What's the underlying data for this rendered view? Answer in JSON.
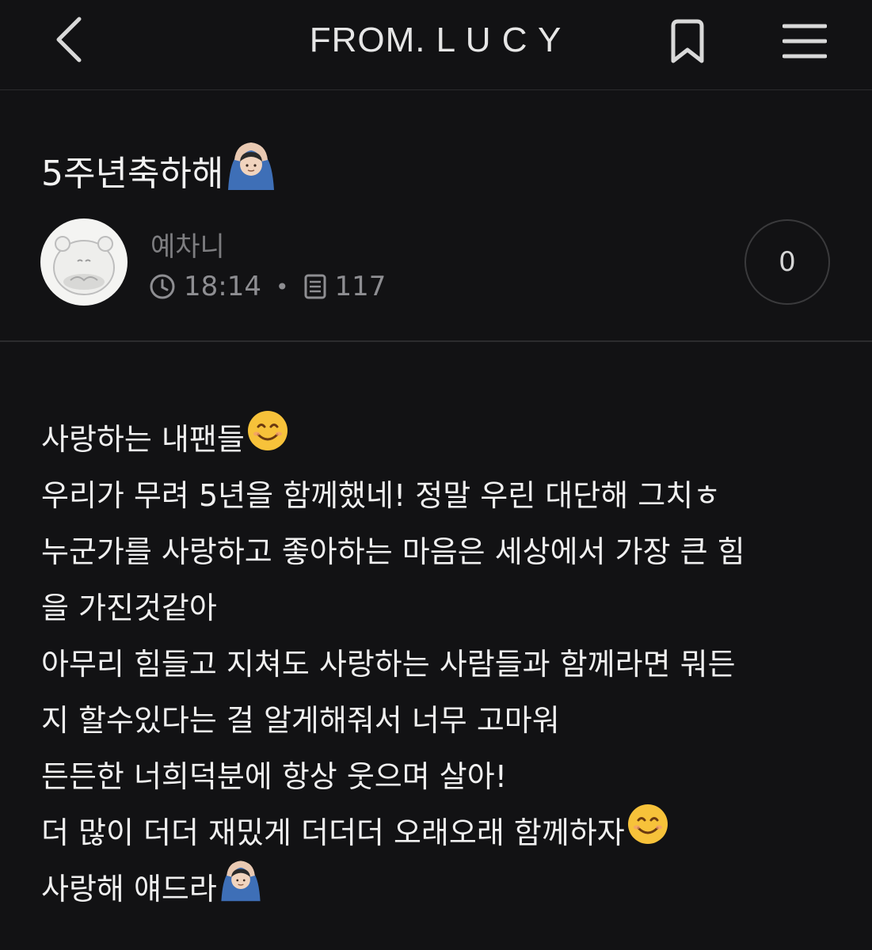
{
  "header": {
    "title": "FROM. L U C Y",
    "back_icon": "chevron-left-icon",
    "bookmark_icon": "bookmark-icon",
    "menu_icon": "hamburger-menu-icon"
  },
  "post": {
    "title": "5주년축하해",
    "title_emoji": "person-gesturing-ok-emoji",
    "author": "예차니",
    "time": "18:14",
    "time_icon": "clock-icon",
    "views": "117",
    "views_icon": "document-icon",
    "comment_count": "0",
    "body_lines": [
      {
        "text": "사랑하는 내팬들",
        "emoji": "smiling-face-emoji"
      },
      {
        "text": "우리가 무려 5년을 함께했네! 정말 우린 대단해 그치ㅎ"
      },
      {
        "text": "누군가를 사랑하고 좋아하는 마음은 세상에서 가장 큰 힘"
      },
      {
        "text": "을 가진것같아"
      },
      {
        "text": "아무리 힘들고 지쳐도 사랑하는 사람들과 함께라면 뭐든"
      },
      {
        "text": "지 할수있다는 걸 알게해줘서 너무 고마워"
      },
      {
        "text": "든든한 너희덕분에 항상 웃으며 살아!"
      },
      {
        "text": "더 많이 더더 재밌게 더더더 오래오래 함께하자",
        "emoji": "smiling-face-emoji"
      },
      {
        "text": "사랑해 얘드라",
        "emoji": "person-gesturing-ok-emoji"
      }
    ]
  },
  "colors": {
    "background": "#121214",
    "text": "#f0f0f0",
    "muted": "#8e8e92",
    "divider": "#2c2c2e"
  }
}
